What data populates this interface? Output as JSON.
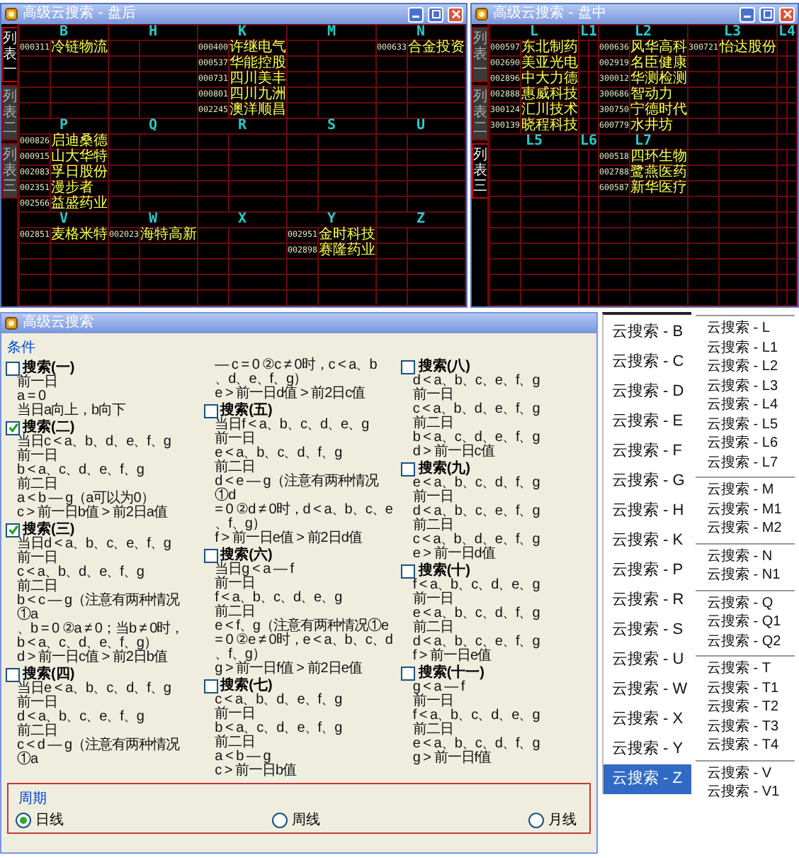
{
  "after_hours_window": {
    "title": "高级云搜索 - 盘后",
    "tabs": [
      {
        "label": "列表一",
        "selected": true
      },
      {
        "label": "列表二",
        "selected": false
      },
      {
        "label": "列表三",
        "selected": false
      }
    ],
    "sections": [
      {
        "columns": [
          {
            "header": "B",
            "entries": [
              {
                "code": "000311",
                "name": "冷链物流"
              }
            ]
          },
          {
            "header": "H"
          },
          {
            "header": "K",
            "entries": [
              {
                "code": "000400",
                "name": "许继电气"
              },
              {
                "code": "000537",
                "name": "华能控股"
              },
              {
                "code": "000731",
                "name": "四川美丰"
              },
              {
                "code": "000801",
                "name": "四川九洲"
              },
              {
                "code": "002245",
                "name": "澳洋顺昌"
              }
            ]
          },
          {
            "header": "M"
          },
          {
            "header": "N",
            "entries": [
              {
                "code": "000633",
                "name": "合金投资"
              }
            ]
          }
        ]
      },
      {
        "columns": [
          {
            "header": "P",
            "entries": [
              {
                "code": "000826",
                "name": "启迪桑德"
              },
              {
                "code": "000915",
                "name": "山大华特"
              },
              {
                "code": "002083",
                "name": "孚日股份"
              },
              {
                "code": "002351",
                "name": "漫步者"
              },
              {
                "code": "002566",
                "name": "益盛药业"
              }
            ]
          },
          {
            "header": "Q"
          },
          {
            "header": "R"
          },
          {
            "header": "S"
          },
          {
            "header": "U"
          }
        ]
      },
      {
        "columns": [
          {
            "header": "V",
            "entries": [
              {
                "code": "002851",
                "name": "麦格米特"
              }
            ]
          },
          {
            "header": "W",
            "entries": [
              {
                "code": "002023",
                "name": "海特高新"
              }
            ]
          },
          {
            "header": "X"
          },
          {
            "header": "Y",
            "entries": [
              {
                "code": "002951",
                "name": "金时科技"
              },
              {
                "code": "002898",
                "name": "赛隆药业"
              }
            ]
          },
          {
            "header": "Z"
          }
        ]
      }
    ]
  },
  "intraday_window": {
    "title": "高级云搜索 - 盘中",
    "tabs": [
      {
        "label": "列表一",
        "selected": false
      },
      {
        "label": "列表二",
        "selected": false
      },
      {
        "label": "列表三",
        "selected": true
      }
    ],
    "sections": [
      {
        "columns": [
          {
            "header": "L",
            "entries": [
              {
                "code": "000597",
                "name": "东北制药"
              },
              {
                "code": "002690",
                "name": "美亚光电"
              },
              {
                "code": "002896",
                "name": "中大力德"
              },
              {
                "code": "002888",
                "name": "惠威科技"
              },
              {
                "code": "300124",
                "name": "汇川技术"
              },
              {
                "code": "300139",
                "name": "晓程科技"
              }
            ]
          },
          {
            "header": "L1"
          },
          {
            "header": "L2",
            "entries": [
              {
                "code": "000636",
                "name": "风华高科"
              },
              {
                "code": "002919",
                "name": "名臣健康"
              },
              {
                "code": "300012",
                "name": "华测检测"
              },
              {
                "code": "300686",
                "name": "智动力"
              },
              {
                "code": "300750",
                "name": "宁德时代"
              },
              {
                "code": "600779",
                "name": "水井坊"
              }
            ]
          },
          {
            "header": "L3",
            "entries": [
              {
                "code": "300721",
                "name": "怡达股份"
              }
            ]
          },
          {
            "header": "L4"
          }
        ]
      },
      {
        "columns": [
          {
            "header": "L5"
          },
          {
            "header": "L6"
          },
          {
            "header": "L7",
            "entries": [
              {
                "code": "000518",
                "name": "四环生物"
              },
              {
                "code": "002788",
                "name": "鹭燕医药"
              },
              {
                "code": "600587",
                "name": "新华医疗"
              }
            ]
          }
        ]
      }
    ]
  },
  "search_dialog": {
    "title": "高级云搜索",
    "conditions_label": "条件",
    "searches": [
      {
        "label": "搜索(一)",
        "checked": false,
        "lines": [
          "前一日",
          "a = 0",
          "当日a向上，b向下"
        ]
      },
      {
        "label": "搜索(二)",
        "checked": true,
        "lines": [
          "当日c < a、b、d、e、f、g",
          "前一日",
          "b < a、c、d、e、f、g",
          "前二日",
          "a < b — g（a可以为0）",
          "c > 前一日b值 > 前2日a值"
        ]
      },
      {
        "label": "搜索(三)",
        "checked": true,
        "lines": [
          "当日d < a、b、c、e、f、g",
          "前一日",
          "c < a、b、d、e、f、g",
          "前二日",
          "b < c — g（注意有两种情况①a",
          "、b = 0 ②a ≠ 0；当b ≠ 0时，",
          "b < a、c、d、e、f、g）",
          "d > 前一日c值 > 前2日b值"
        ]
      },
      {
        "label": "搜索(四)",
        "checked": false,
        "lines": [
          "当日e < a、b、c、d、f、g",
          "前一日",
          "d < a、b、c、e、f、g",
          "前二日",
          "c < d — g（注意有两种情况①a",
          "— c = 0 ②c ≠ 0时，c < a、b",
          "、d、e、f、g）",
          "e > 前一日d值 > 前2日c值"
        ]
      },
      {
        "label": "搜索(五)",
        "checked": false,
        "lines": [
          "当日f < a、b、c、d、e、g",
          "前一日",
          "e < a、b、c、d、f、g",
          "前二日",
          "d < e — g（注意有两种情况①d",
          "= 0 ②d ≠ 0时，d < a、b、c、e",
          "、f、g）",
          "f > 前一日e值 > 前2日d值"
        ]
      },
      {
        "label": "搜索(六)",
        "checked": false,
        "lines": [
          "当日g < a — f",
          "前一日",
          "f < a、b、c、d、e、g",
          "前二日",
          "e < f、g（注意有两种情况①e",
          "= 0 ②e ≠ 0时，e < a、b、c、d",
          "、f、g）",
          "g > 前一日f值 > 前2日e值"
        ]
      },
      {
        "label": "搜索(七)",
        "checked": false,
        "lines": [
          "c < a、b、d、e、f、g",
          "前一日",
          "b < a、c、d、e、f、g",
          "前二日",
          "a < b — g",
          "c > 前一日b值"
        ]
      },
      {
        "label": "搜索(八)",
        "checked": false,
        "lines": [
          "d < a、b、c、e、f、g",
          "前一日",
          "c < a、b、d、e、f、g",
          "前二日",
          "b < a、c、d、e、f、g",
          "d > 前一日c值"
        ]
      },
      {
        "label": "搜索(九)",
        "checked": false,
        "lines": [
          "e < a、b、c、d、f、g",
          "前一日",
          "d < a、b、c、e、f、g",
          "前二日",
          "c < a、b、d、e、f、g",
          "e > 前一日d值"
        ]
      },
      {
        "label": "搜索(十)",
        "checked": false,
        "lines": [
          "f < a、b、c、d、e、g",
          "前一日",
          "e < a、b、c、d、f、g",
          "前二日",
          "d < a、b、c、e、f、g",
          "f > 前一日e值"
        ]
      },
      {
        "label": "搜索(十一)",
        "checked": false,
        "lines": [
          "g < a — f",
          "前一日",
          "f < a、b、c、d、e、g",
          "前二日",
          "e < a、b、c、d、f、g",
          "g > 前一日f值"
        ]
      }
    ],
    "period": {
      "label": "周期",
      "options": [
        {
          "label": "日线",
          "selected": true
        },
        {
          "label": "周线",
          "selected": false
        },
        {
          "label": "月线",
          "selected": false
        }
      ]
    }
  },
  "search_list": {
    "items": [
      {
        "label": "云搜索 - B",
        "selected": false
      },
      {
        "label": "云搜索 - C",
        "selected": false
      },
      {
        "label": "云搜索 - D",
        "selected": false
      },
      {
        "label": "云搜索 - E",
        "selected": false
      },
      {
        "label": "云搜索 - F",
        "selected": false
      },
      {
        "label": "云搜索 - G",
        "selected": false
      },
      {
        "label": "云搜索 - H",
        "selected": false
      },
      {
        "label": "云搜索 - K",
        "selected": false
      },
      {
        "label": "云搜索 - P",
        "selected": false
      },
      {
        "label": "云搜索 - R",
        "selected": false
      },
      {
        "label": "云搜索 - S",
        "selected": false
      },
      {
        "label": "云搜索 - U",
        "selected": false
      },
      {
        "label": "云搜索 - W",
        "selected": false
      },
      {
        "label": "云搜索 - X",
        "selected": false
      },
      {
        "label": "云搜索 - Y",
        "selected": false
      },
      {
        "label": "云搜索 - Z",
        "selected": true
      }
    ]
  },
  "grouped_search_list": {
    "groups": [
      {
        "items": [
          {
            "label": "云搜索 - L",
            "selected": false
          },
          {
            "label": "云搜索 - L1",
            "selected": false
          },
          {
            "label": "云搜索 - L2",
            "selected": false
          },
          {
            "label": "云搜索 - L3",
            "selected": false
          },
          {
            "label": "云搜索 - L4",
            "selected": false
          },
          {
            "label": "云搜索 - L5",
            "selected": false
          },
          {
            "label": "云搜索 - L6",
            "selected": false
          },
          {
            "label": "云搜索 - L7",
            "selected": false
          }
        ]
      },
      {
        "items": [
          {
            "label": "云搜索 - M",
            "selected": false
          },
          {
            "label": "云搜索 - M1",
            "selected": false
          },
          {
            "label": "云搜索 - M2",
            "selected": false
          }
        ]
      },
      {
        "items": [
          {
            "label": "云搜索 - N",
            "selected": false
          },
          {
            "label": "云搜索 - N1",
            "selected": false
          }
        ]
      },
      {
        "items": [
          {
            "label": "云搜索 - Q",
            "selected": false
          },
          {
            "label": "云搜索 - Q1",
            "selected": false
          },
          {
            "label": "云搜索 - Q2",
            "selected": false
          }
        ]
      },
      {
        "items": [
          {
            "label": "云搜索 - T",
            "selected": false
          },
          {
            "label": "云搜索 - T1",
            "selected": false
          },
          {
            "label": "云搜索 - T2",
            "selected": false
          },
          {
            "label": "云搜索 - T3",
            "selected": false
          },
          {
            "label": "云搜索 - T4",
            "selected": false
          }
        ]
      },
      {
        "items": [
          {
            "label": "云搜索 - V",
            "selected": false
          },
          {
            "label": "云搜索 - V1",
            "selected": false
          }
        ]
      }
    ]
  }
}
